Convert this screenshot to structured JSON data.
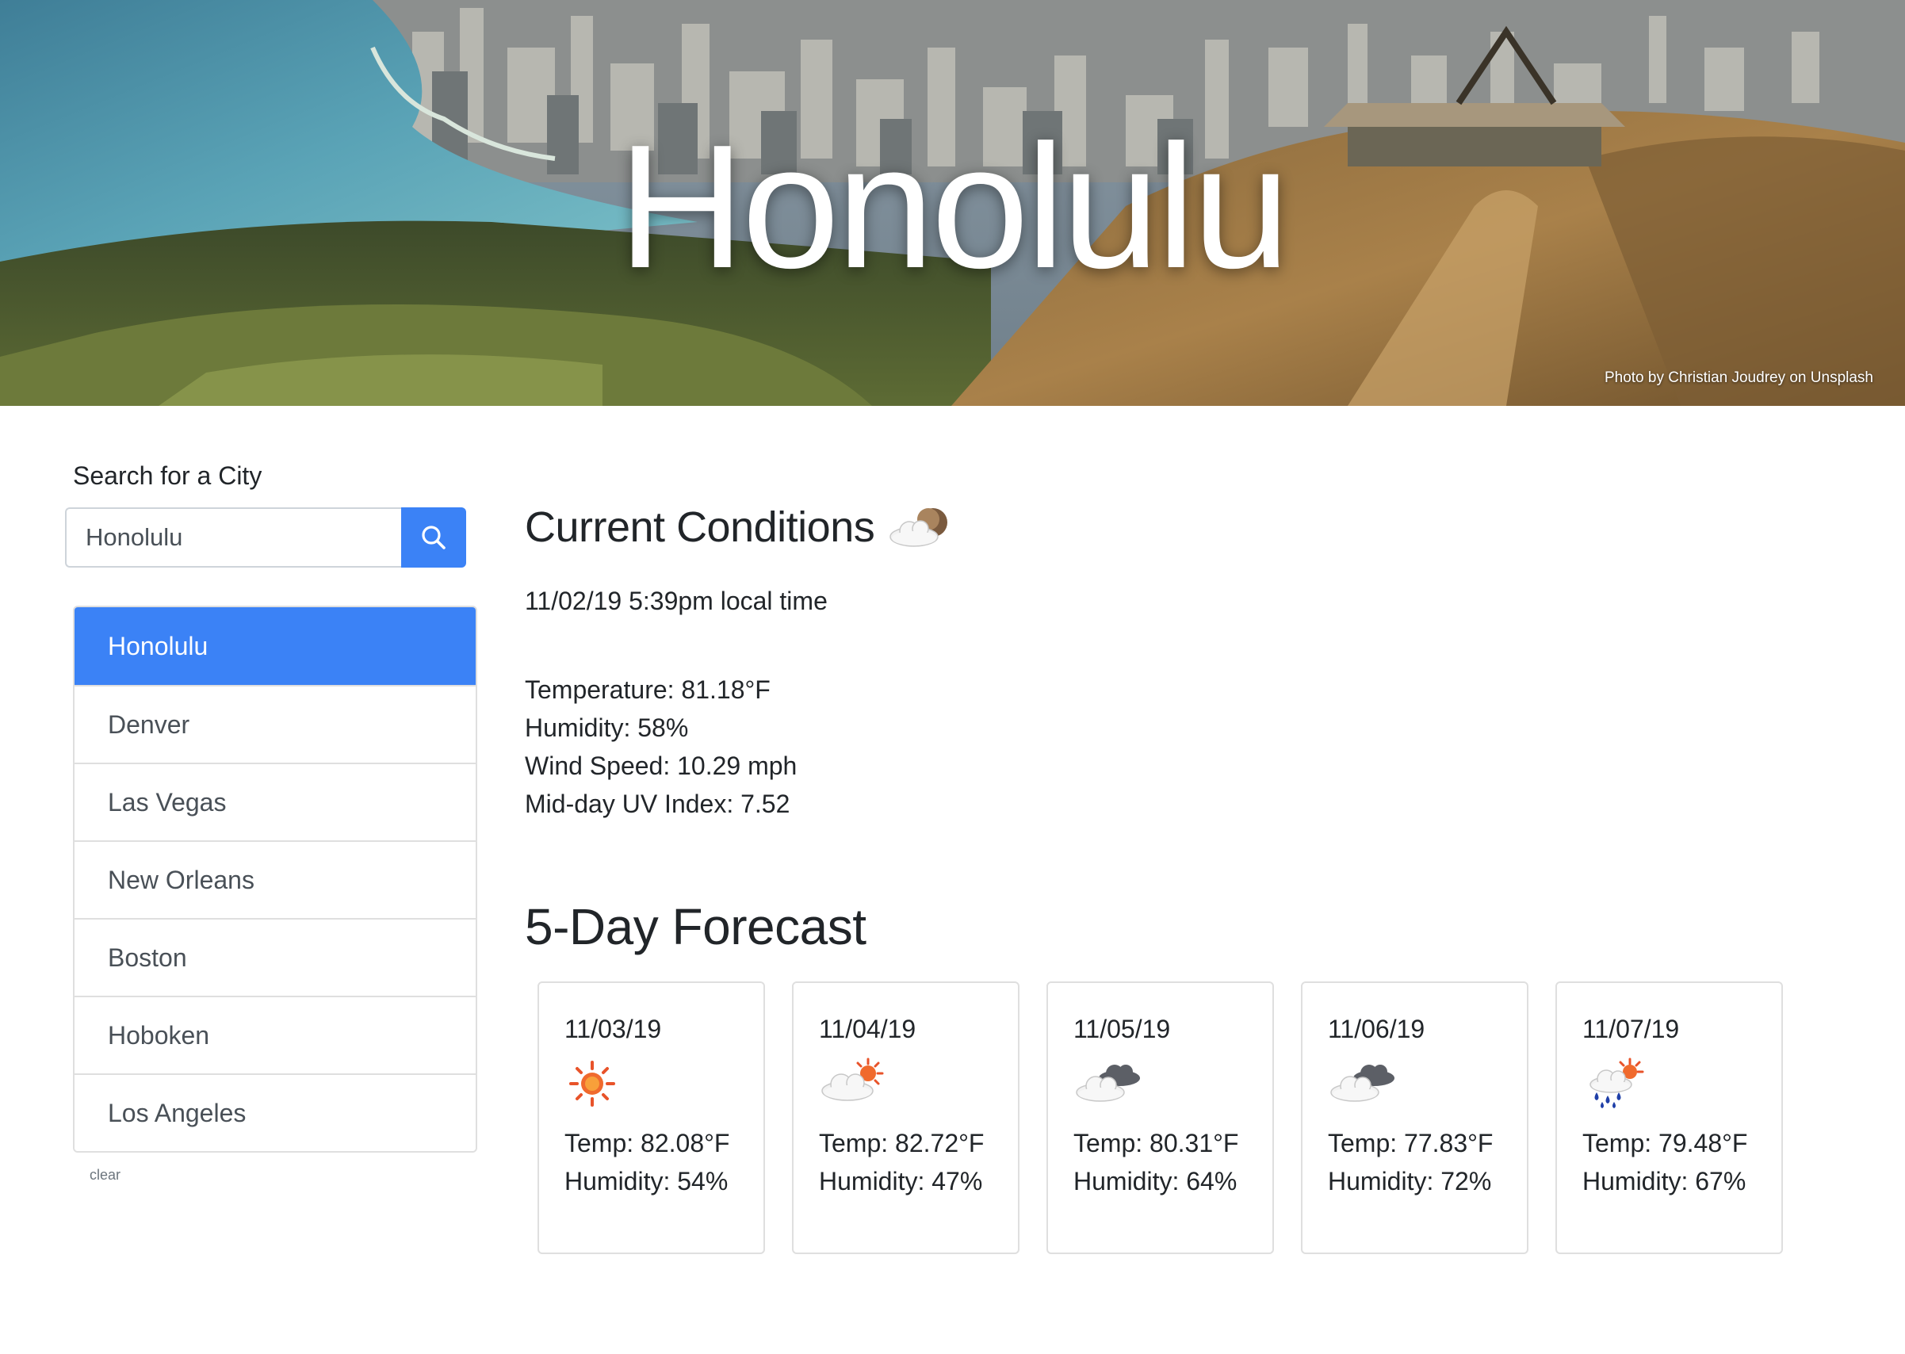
{
  "hero": {
    "city_title": "Honolulu",
    "photo_credit": "Photo by Christian Joudrey on Unsplash"
  },
  "sidebar": {
    "search_label": "Search for a City",
    "search_value": "Honolulu",
    "cities": [
      "Honolulu",
      "Denver",
      "Las Vegas",
      "New Orleans",
      "Boston",
      "Hoboken",
      "Los Angeles"
    ],
    "active_city": "Honolulu",
    "clear_label": "clear"
  },
  "current": {
    "title": "Current Conditions",
    "icon": "cloud-moon-icon",
    "time": "11/02/19 5:39pm local time",
    "temperature": "Temperature: 81.18°F",
    "humidity": "Humidity: 58%",
    "wind": "Wind Speed: 10.29 mph",
    "uv": "Mid-day UV Index: 7.52"
  },
  "forecast": {
    "title": "5-Day Forecast",
    "days": [
      {
        "date": "11/03/19",
        "icon": "sun-icon",
        "temp": "Temp: 82.08°F",
        "humidity": "Humidity: 54%"
      },
      {
        "date": "11/04/19",
        "icon": "sun-cloud-icon",
        "temp": "Temp: 82.72°F",
        "humidity": "Humidity: 47%"
      },
      {
        "date": "11/05/19",
        "icon": "clouds-icon",
        "temp": "Temp: 80.31°F",
        "humidity": "Humidity: 64%"
      },
      {
        "date": "11/06/19",
        "icon": "clouds-icon",
        "temp": "Temp: 77.83°F",
        "humidity": "Humidity: 72%"
      },
      {
        "date": "11/07/19",
        "icon": "sun-rain-icon",
        "temp": "Temp: 79.48°F",
        "humidity": "Humidity: 67%"
      }
    ]
  },
  "colors": {
    "accent": "#3b82f6",
    "text": "#212529",
    "muted": "#6c757d",
    "border": "#dfdfdf"
  }
}
